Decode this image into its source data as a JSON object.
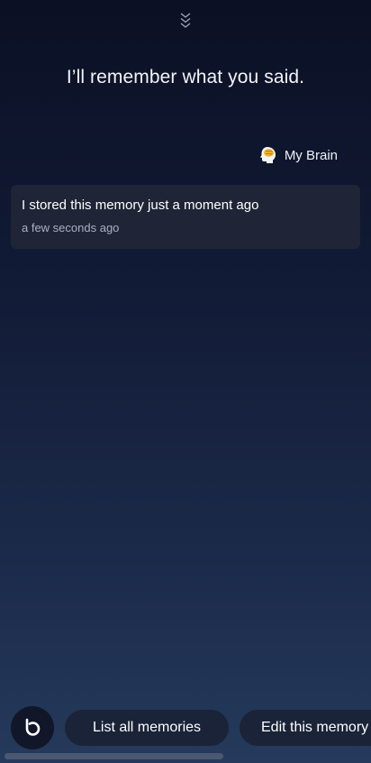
{
  "header": {
    "collapse_icon": "double-chevron-down-icon"
  },
  "headline": "I’ll remember what you said.",
  "source": {
    "icon": "brain-icon",
    "label": "My Brain"
  },
  "memory": {
    "text": "I stored this memory just a moment ago",
    "time": "a few seconds ago"
  },
  "bottom": {
    "assistant_icon": "bixby-icon",
    "suggestions": [
      {
        "label": "List all memories"
      },
      {
        "label": "Edit this memory"
      }
    ]
  },
  "colors": {
    "background_top": "#0b1024",
    "background_bottom": "#253a5c",
    "card": "#1f2536",
    "chip": "#1a2338"
  }
}
